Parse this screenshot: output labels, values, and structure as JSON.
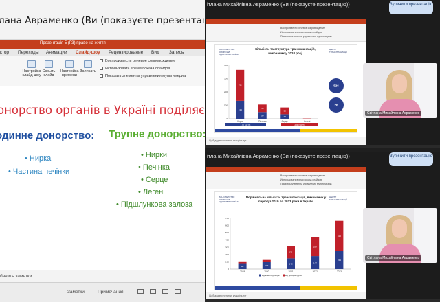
{
  "left": {
    "header_title": "лана Авраменко (Ви (показуєте презентацію))",
    "ppt": {
      "doc_title": "Презентація 5 (ГЗ) право на життя",
      "tabs": [
        "ктор",
        "Переходы",
        "Анимации",
        "Слайд-шоу",
        "Рецензирование",
        "Вид",
        "Запись"
      ],
      "active_tab": "Слайд-шоу",
      "ribbon_buttons": [
        "Настройка слайд-шоу",
        "Скрыть слайд",
        "Настройка времени",
        "Записать"
      ],
      "ribbon_checks": [
        "Воспроизвести речевое сопровождение",
        "Использовать время показа слайдов",
        "Показать элементы управления мультимедиа"
      ]
    },
    "slide": {
      "title": "онорство органів в Україні поділяється",
      "sub1": "одинне донорство:",
      "sub2": "Трупне донорство:",
      "left_items": [
        "• Нирка",
        "• Частина печінки"
      ],
      "right_items": [
        "• Нирки",
        "• Печінка",
        "• Серце",
        "• Легені",
        "• Підшлункова залоза"
      ]
    },
    "notes_label": "бавить заметки",
    "status": {
      "notes": "Заметки",
      "comments": "Примечания"
    },
    "colors": {
      "ppt_red": "#c43e1c",
      "title_red": "#d6313a",
      "blue": "#1f4fa0",
      "green": "#5aae32"
    }
  },
  "right_top": {
    "header_title": "ітлана Михайлівна Авраменко (Ви (показуєте презентацію))",
    "button_label": "Зупинити презентацію",
    "slide_title": "Кількість та структура трансплантацій, виконаних у 2024 році",
    "logo_left": "МІНІСТЕРСТВО ОХОРОНИ ЗДОРОВ'Я УКРАЇНИ",
    "logo_right": "ЦЕНТР ТРАНСПЛАНТАЦІЇ",
    "circle1": "526",
    "circle2": "26",
    "notes": "Щоб додати нотатки, клацніть тут",
    "camera_name": "Світлана Михайлівна Авраменко",
    "chart_data": {
      "type": "bar",
      "categories": [
        "Нирка",
        "Печінка",
        "Серце",
        "Легені"
      ],
      "series": [
        {
          "name": "",
          "values": [
            134,
            50,
            34,
            0
          ]
        },
        {
          "name": "",
          "values": [
            231,
            56,
            50,
            2
          ]
        }
      ],
      "bottom_left": "170 (34%)",
      "bottom_right": "356 (68 %)",
      "ylim": [
        0,
        400
      ]
    }
  },
  "right_bottom": {
    "header_title": "ітлана Михайлівна Авраменко (Ви (показуєте презентацію))",
    "button_label": "Зупинити презентацію",
    "slide_title": "Порівняльна кількість трансплантацій, виконаних у період з 2019 по 2023 роки в Україні",
    "logo_left": "МІНІСТЕРСТВО ОХОРОНИ ЗДОРОВ'Я УКРАЇНИ",
    "logo_right": "ЦЕНТР ТРАНСПЛАНТАЦІЇ",
    "notes": "Щоб додати нотатки, клацніть тут",
    "camera_name": "Світлана Михайлівна Авраменко",
    "chart_data": {
      "type": "bar",
      "categories": [
        "2019",
        "2020",
        "2021",
        "2022",
        "2023"
      ],
      "series": [
        {
          "name": "від живого донора",
          "values": [
            80,
            103,
            148,
            179,
            249
          ]
        },
        {
          "name": "від донора-трупа",
          "values": [
            26,
            23,
            171,
            259,
            416
          ]
        }
      ],
      "ylim": [
        0,
        700
      ]
    }
  }
}
